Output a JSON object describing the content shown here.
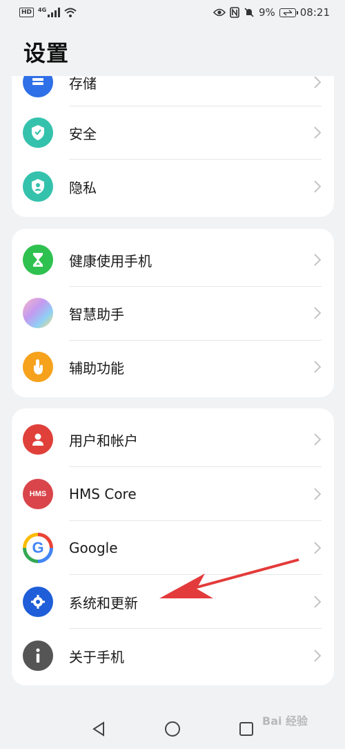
{
  "status_bar": {
    "hd": "HD",
    "network": "4G",
    "battery_percent": "9%",
    "time": "08:21",
    "icons": [
      "signal-icon",
      "wifi-icon",
      "eye-icon",
      "nfc-icon",
      "mute-icon",
      "battery-icon"
    ]
  },
  "page": {
    "title": "设置"
  },
  "group1": {
    "items": [
      {
        "label": "存储",
        "icon": "storage-icon",
        "color": "#2f6fe8"
      },
      {
        "label": "安全",
        "icon": "shield-icon",
        "color": "#35c2ad"
      },
      {
        "label": "隐私",
        "icon": "privacy-icon",
        "color": "#35c2ad"
      }
    ]
  },
  "group2": {
    "items": [
      {
        "label": "健康使用手机",
        "icon": "hourglass-icon",
        "color": "#2fc14f"
      },
      {
        "label": "智慧助手",
        "icon": "assistant-icon",
        "color": "#a98be8"
      },
      {
        "label": "辅助功能",
        "icon": "hand-icon",
        "color": "#f6a21c"
      }
    ]
  },
  "group3": {
    "items": [
      {
        "label": "用户和帐户",
        "icon": "user-icon",
        "color": "#e0403a"
      },
      {
        "label": "HMS Core",
        "icon": "hms-icon",
        "icon_text": "HMS",
        "color": "#d9454a"
      },
      {
        "label": "Google",
        "icon": "google-icon",
        "icon_text": "G",
        "color": "#4285f4"
      },
      {
        "label": "系统和更新",
        "icon": "gear-icon",
        "color": "#1f5ed8"
      },
      {
        "label": "关于手机",
        "icon": "info-icon",
        "color": "#555555"
      }
    ]
  },
  "watermark": {
    "text": "Bai 经验"
  },
  "nav": {
    "icons": [
      "back-icon",
      "home-icon",
      "recents-icon"
    ]
  }
}
